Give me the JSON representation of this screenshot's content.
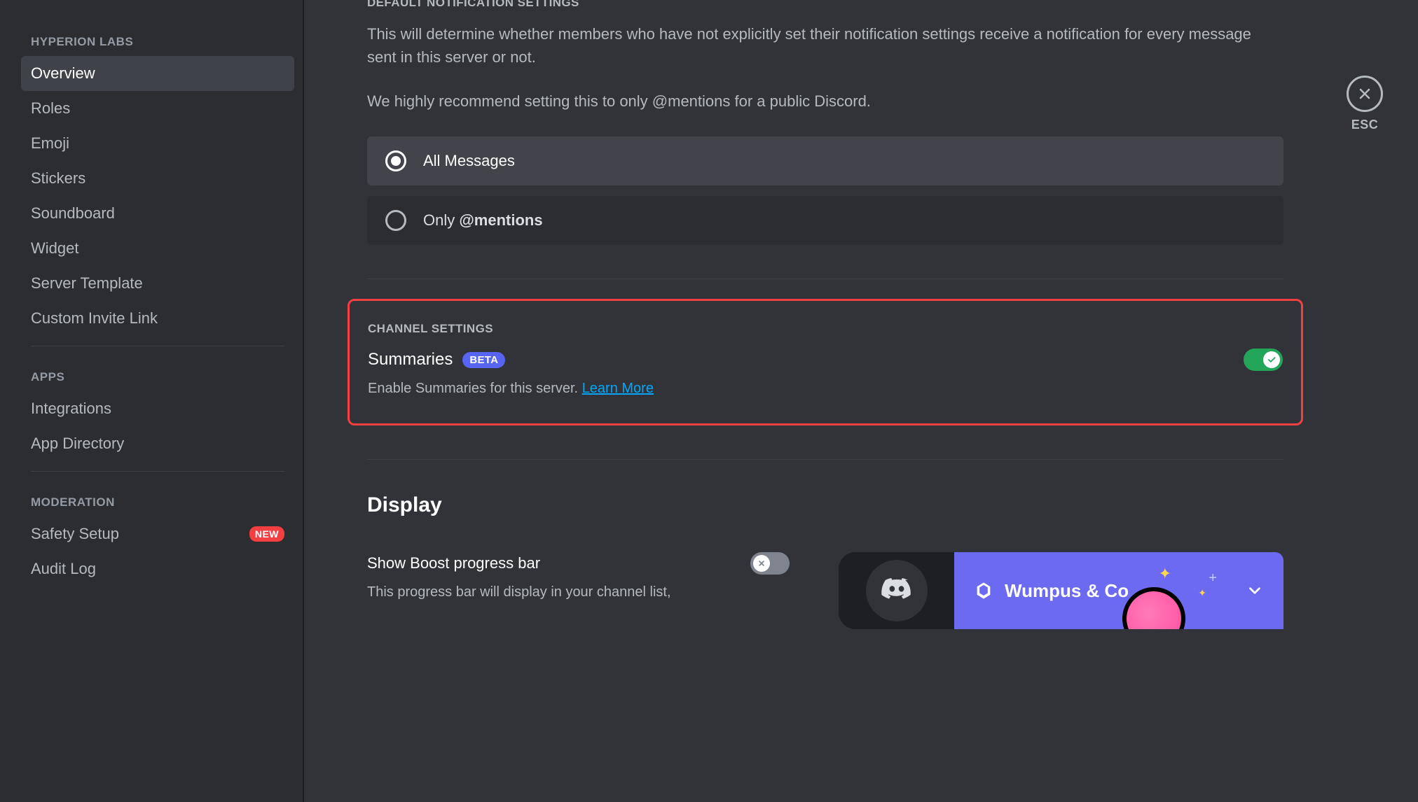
{
  "sidebar": {
    "server_name_header": "HYPERION LABS",
    "groups": [
      {
        "header": "HYPERION LABS",
        "items": [
          {
            "label": "Overview",
            "active": true
          },
          {
            "label": "Roles"
          },
          {
            "label": "Emoji"
          },
          {
            "label": "Stickers"
          },
          {
            "label": "Soundboard"
          },
          {
            "label": "Widget"
          },
          {
            "label": "Server Template"
          },
          {
            "label": "Custom Invite Link"
          }
        ]
      },
      {
        "header": "APPS",
        "items": [
          {
            "label": "Integrations"
          },
          {
            "label": "App Directory"
          }
        ]
      },
      {
        "header": "MODERATION",
        "items": [
          {
            "label": "Safety Setup",
            "badge": "NEW"
          },
          {
            "label": "Audit Log"
          }
        ]
      }
    ]
  },
  "close": {
    "label": "ESC"
  },
  "notification": {
    "eyebrow": "DEFAULT NOTIFICATION SETTINGS",
    "description": "This will determine whether members who have not explicitly set their notification settings receive a notification for every message sent in this server or not.",
    "recommend": "We highly recommend setting this to only @mentions for a public Discord.",
    "options": [
      {
        "label": "All Messages",
        "selected": true
      },
      {
        "label_pre": "Only ",
        "label_strong": "@mentions",
        "selected": false
      }
    ]
  },
  "channel_settings": {
    "eyebrow": "CHANNEL SETTINGS",
    "title": "Summaries",
    "badge": "BETA",
    "help": "Enable Summaries for this server. ",
    "learn_more": "Learn More",
    "enabled": true
  },
  "display": {
    "heading": "Display",
    "boost": {
      "title": "Show Boost progress bar",
      "desc": "This progress bar will display in your channel list,",
      "enabled": false,
      "server_preview_name": "Wumpus & Co"
    }
  },
  "colors": {
    "accent": "#5865f2",
    "danger": "#f23f42",
    "success": "#23a55a",
    "link": "#00a8fc"
  }
}
